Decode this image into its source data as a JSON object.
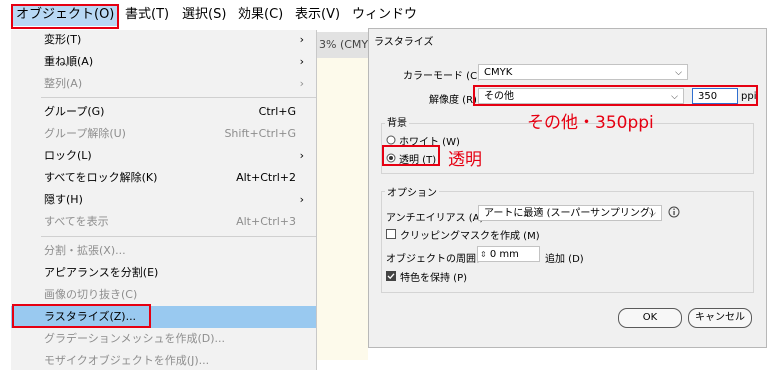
{
  "menubar": {
    "items": [
      "オブジェクト(O)",
      "書式(T)",
      "選択(S)",
      "効果(C)",
      "表示(V)",
      "ウィンドウ"
    ]
  },
  "menu": {
    "transform": {
      "label": "変形(T)"
    },
    "arrange": {
      "label": "重ね順(A)"
    },
    "align": {
      "label": "整列(A)"
    },
    "group": {
      "label": "グループ(G)",
      "shortcut": "Ctrl+G"
    },
    "ungroup": {
      "label": "グループ解除(U)",
      "shortcut": "Shift+Ctrl+G"
    },
    "lock": {
      "label": "ロック(L)"
    },
    "unlock_all": {
      "label": "すべてをロック解除(K)",
      "shortcut": "Alt+Ctrl+2"
    },
    "hide": {
      "label": "隠す(H)"
    },
    "show_all": {
      "label": "すべてを表示",
      "shortcut": "Alt+Ctrl+3"
    },
    "expand": {
      "label": "分割・拡張(X)..."
    },
    "expand_appearance": {
      "label": "アピアランスを分割(E)"
    },
    "crop_image": {
      "label": "画像の切り抜き(C)"
    },
    "rasterize": {
      "label": "ラスタライズ(Z)..."
    },
    "gradient_mesh": {
      "label": "グラデーションメッシュを作成(D)..."
    },
    "mosaic": {
      "label": "モザイクオブジェクトを作成(J)..."
    },
    "submenu_arrow": "›"
  },
  "document": {
    "tab_text": "3% (CMYK"
  },
  "dialog": {
    "title": "ラスタライズ",
    "color_mode_label": "カラーモード (C) :",
    "color_mode_value": "CMYK",
    "resolution_label": "解像度 (R)",
    "resolution_value": "その他",
    "ppi_value": "350",
    "ppi_unit": "ppi",
    "background_title": "背景",
    "white_label": "ホワイト (W)",
    "transparent_label": "透明 (T)",
    "options_title": "オプション",
    "antialias_label": "アンチエイリアス (A) :",
    "antialias_value": "アートに最適 (スーパーサンプリング)",
    "clipping_label": "クリッピングマスクを作成 (M)",
    "around_label": "オブジェクトの周囲に",
    "around_value": "0 mm",
    "add_label": "追加 (D)",
    "spot_label": "特色を保持 (P)",
    "ok_label": "OK",
    "cancel_label": "キャンセル"
  },
  "annotations": {
    "resolution_note": "その他・350ppi",
    "transparent_note": "透明"
  },
  "colors": {
    "annotation_red": "#e60012",
    "menu_highlight": "#99c9f0"
  }
}
